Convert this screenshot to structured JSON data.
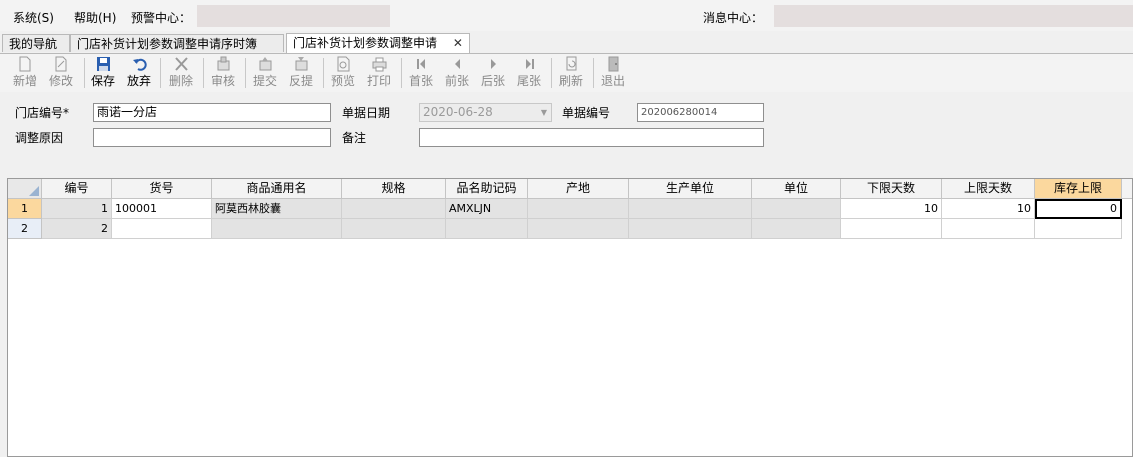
{
  "menubar": {
    "system": "系统(S)",
    "help": "帮助(H)",
    "alert_label": "预警中心：",
    "message_label": "消息中心："
  },
  "tabs": [
    {
      "label": "我的导航"
    },
    {
      "label": "门店补货计划参数调整申请序时簿"
    },
    {
      "label": "门店补货计划参数调整申请"
    }
  ],
  "toolbar": {
    "new": "新增",
    "edit": "修改",
    "save": "保存",
    "discard": "放弃",
    "delete": "删除",
    "audit": "审核",
    "submit": "提交",
    "unsubmit": "反提",
    "preview": "预览",
    "print": "打印",
    "first": "首张",
    "prev": "前张",
    "next": "后张",
    "last": "尾张",
    "refresh": "刷新",
    "exit": "退出"
  },
  "form": {
    "store_code_label": "门店编号*",
    "store_code_value": "雨诺一分店",
    "doc_date_label": "单据日期",
    "doc_date_value": "2020-06-28",
    "doc_no_label": "单据编号",
    "doc_no_value": "202006280014",
    "reason_label": "调整原因",
    "reason_value": "",
    "remark_label": "备注",
    "remark_value": ""
  },
  "grid": {
    "columns": [
      "编号",
      "货号",
      "商品通用名",
      "规格",
      "品名助记码",
      "产地",
      "生产单位",
      "单位",
      "下限天数",
      "上限天数",
      "库存上限"
    ],
    "rows": [
      {
        "row_no": "1",
        "id": "1",
        "item_no": "100001",
        "name": "阿莫西林胶囊",
        "spec": "",
        "mnemonic": "AMXLJN",
        "origin": "",
        "maker": "",
        "unit": "",
        "min_days": "10",
        "max_days": "10",
        "stock_max": "0"
      },
      {
        "row_no": "2",
        "id": "2",
        "item_no": "",
        "name": "",
        "spec": "",
        "mnemonic": "",
        "origin": "",
        "maker": "",
        "unit": "",
        "min_days": "",
        "max_days": "",
        "stock_max": ""
      }
    ]
  },
  "icons": {
    "new": "new-document-icon",
    "edit": "edit-document-icon",
    "save": "floppy-disk-icon",
    "discard": "undo-arrow-icon",
    "delete": "x-delete-icon",
    "audit": "stamp-icon",
    "submit": "submit-icon",
    "unsubmit": "unsubmit-icon",
    "preview": "preview-icon",
    "print": "printer-icon",
    "first": "first-record-icon",
    "prev": "previous-record-icon",
    "next": "next-record-icon",
    "last": "last-record-icon",
    "refresh": "refresh-icon",
    "exit": "exit-door-icon",
    "close": "close-icon"
  },
  "colors": {
    "selected_header": "#fbd89e",
    "readonly_cell": "#e3e3e3",
    "row_header": "#e8eef7",
    "accent_blue": "#1f5fb5"
  }
}
